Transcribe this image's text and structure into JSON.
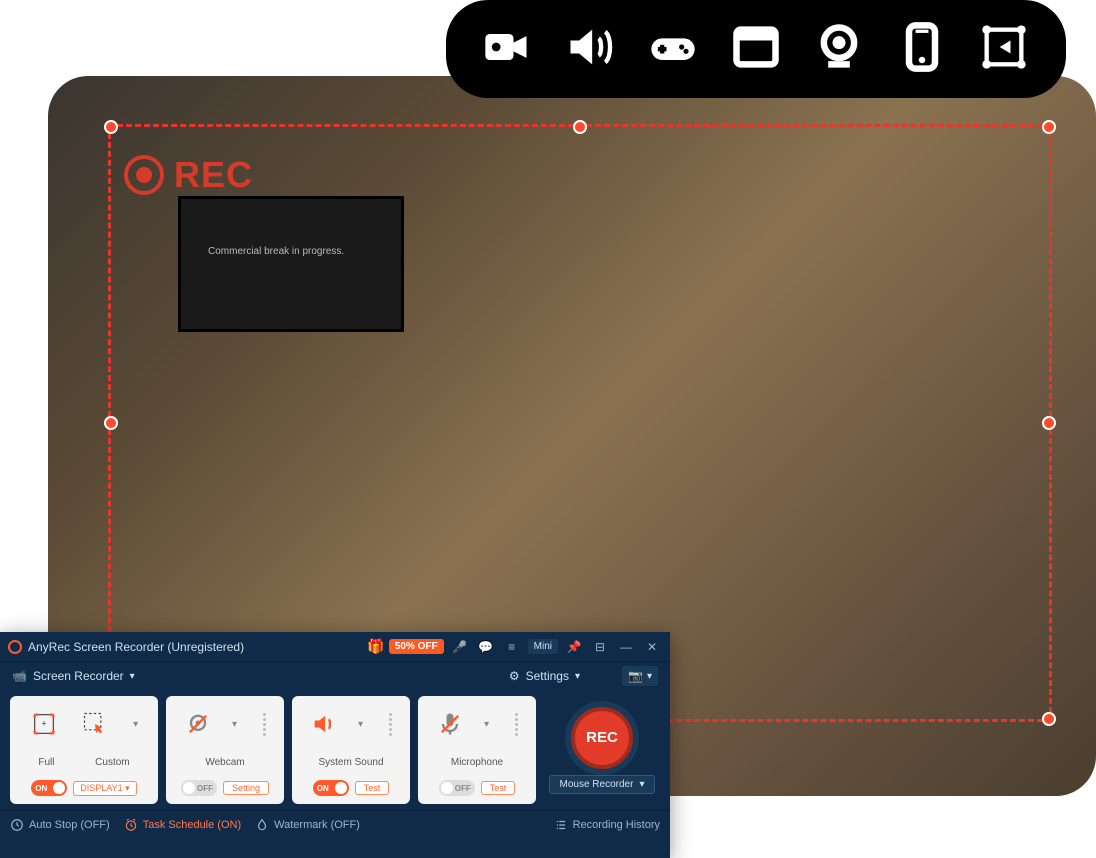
{
  "bg_tv_text": "Commercial break in progress.",
  "toolbar_icons": [
    "video-camera",
    "speaker",
    "gamepad",
    "window",
    "webcam",
    "phone",
    "area"
  ],
  "rec_indicator_label": "REC",
  "app": {
    "title": "AnyRec Screen Recorder (Unregistered)",
    "discount_label": "50% OFF",
    "mini_label": "Mini",
    "settings_label": "Settings",
    "mode_label": "Screen Recorder",
    "panels": {
      "display": {
        "full_label": "Full",
        "custom_label": "Custom",
        "toggle_state": "ON",
        "select_value": "DISPLAY1"
      },
      "webcam": {
        "label": "Webcam",
        "toggle_state": "OFF",
        "button_label": "Setting"
      },
      "sound": {
        "label": "System Sound",
        "toggle_state": "ON",
        "button_label": "Test"
      },
      "mic": {
        "label": "Microphone",
        "toggle_state": "OFF",
        "button_label": "Test"
      }
    },
    "rec_button": "REC",
    "mouse_recorder_label": "Mouse Recorder",
    "footer": {
      "auto_stop": "Auto Stop (OFF)",
      "task_schedule": "Task Schedule (ON)",
      "watermark": "Watermark (OFF)",
      "history": "Recording History"
    }
  }
}
